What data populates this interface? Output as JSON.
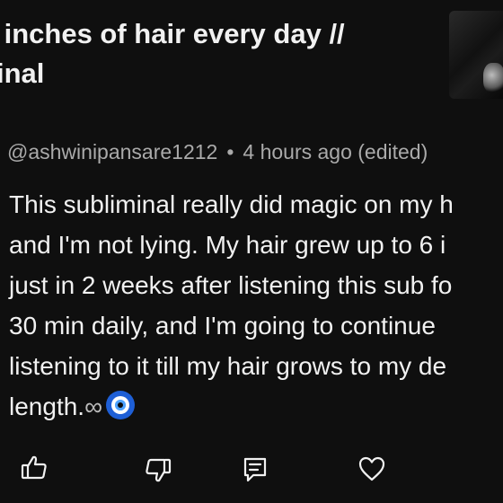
{
  "video": {
    "title": " inches of hair every day //\ninal"
  },
  "comment": {
    "author": "@ashwinipansare1212",
    "separator": "•",
    "time": "4 hours ago (edited)",
    "text": "This subliminal really did magic on my h\nand I'm not lying. My hair grew up to 6 i\njust in 2 weeks after listening this sub fo\n30 min daily, and I'm going to continue\nlistening to it till my hair grows to my de\nlength.",
    "emoji_infinity": "∞"
  },
  "actions": {
    "icons": [
      "thumbs-up-icon",
      "thumbs-down-icon",
      "reply-icon",
      "heart-icon"
    ]
  },
  "colors": {
    "background": "#0f0f0f",
    "text": "#f1f1f1",
    "meta": "#aaaaaa"
  }
}
